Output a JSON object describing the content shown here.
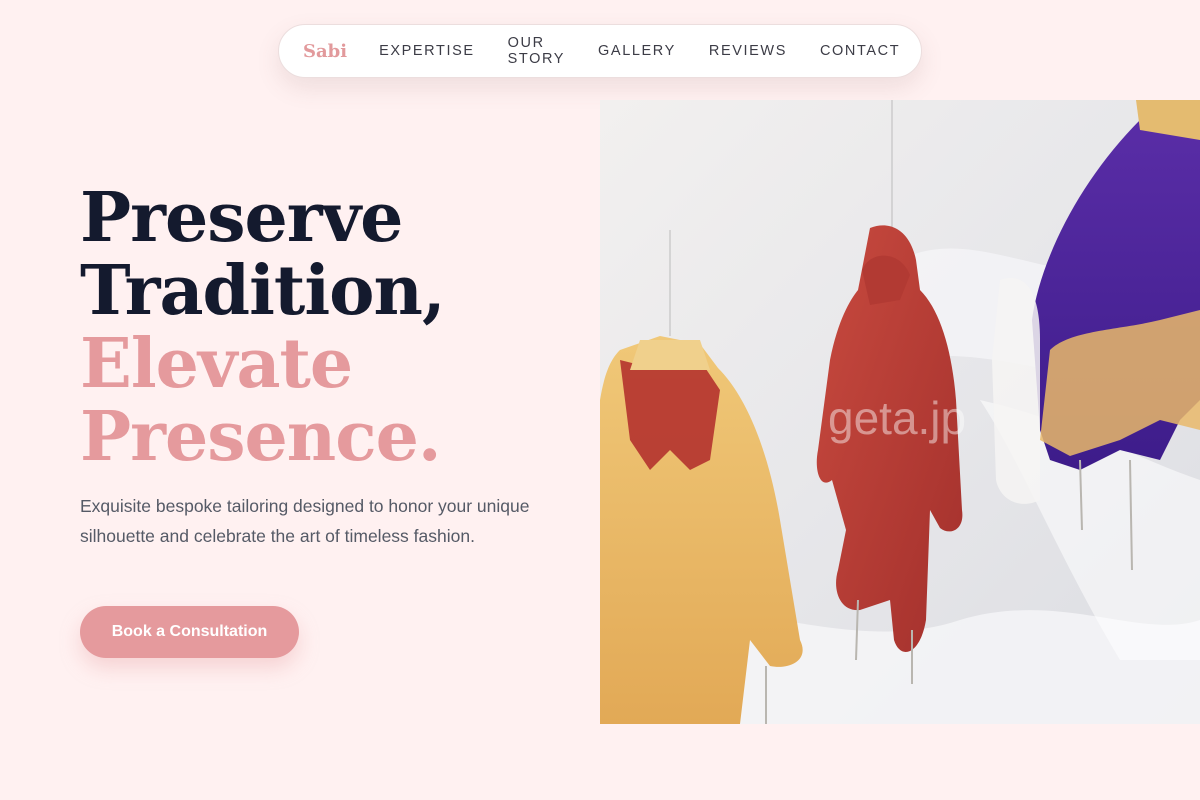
{
  "nav": {
    "brand": "Sabi",
    "links": [
      "EXPERTISE",
      "OUR STORY",
      "GALLERY",
      "REVIEWS",
      "CONTACT"
    ]
  },
  "hero": {
    "headline_line1": "Preserve",
    "headline_line2": "Tradition,",
    "headline_line3": "Elevate",
    "headline_line4": "Presence.",
    "lead": "Exquisite bespoke tailoring designed to honor your unique silhouette and celebrate the art of timeless fashion.",
    "cta_label": "Book a Consultation",
    "image_watermark": "geta.jp"
  },
  "colors": {
    "background": "#fff1f1",
    "accent_pink": "#e59a9d",
    "headline_dark": "#141a2e",
    "body_text": "#555a66"
  }
}
